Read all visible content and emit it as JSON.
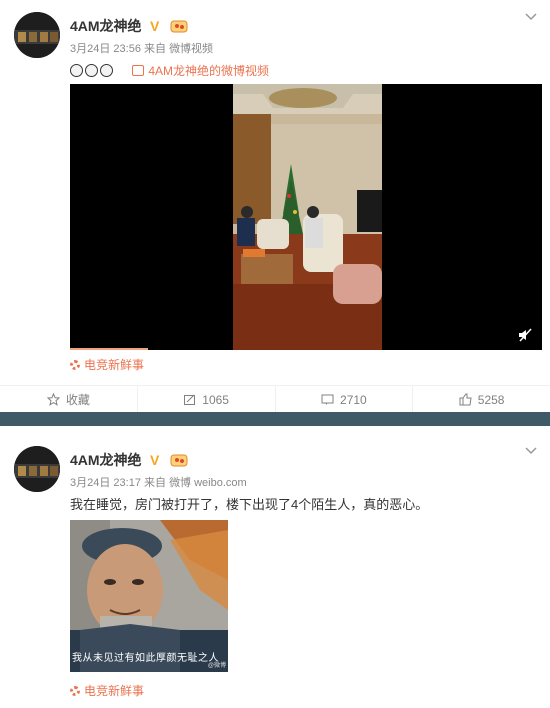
{
  "post1": {
    "username": "4AM龙神绝",
    "date": "3月24日 23:56",
    "from_prefix": "来自",
    "from_source": "微博视频",
    "emoji_text": "😂😂😂",
    "video_link": "4AM龙神绝的微博视频",
    "source_tag": "电竞新鲜事",
    "video_progress": 0.165,
    "actions": {
      "favorite_label": "收藏",
      "repost_count": "1065",
      "comment_count": "2710",
      "like_count": "5258"
    }
  },
  "post2": {
    "username": "4AM龙神绝",
    "date": "3月24日 23:17",
    "from_prefix": "来自",
    "from_source": "微博 weibo.com",
    "text": "我在睡觉，房门被打开了，楼下出现了4个陌生人，真的恶心。",
    "image_subtitle": "我从未见过有如此厚颜无耻之人",
    "image_watermark": "@微博",
    "source_tag": "电竞新鲜事"
  },
  "colors": {
    "accent": "#eb7350",
    "divider": "#3d5a66",
    "verified": "#f6a623"
  },
  "icons": [
    "chevron-down-icon",
    "verified-icon",
    "level-icon",
    "video-icon",
    "mute-icon",
    "star-icon",
    "repost-icon",
    "comment-icon",
    "like-icon",
    "flower-icon"
  ]
}
